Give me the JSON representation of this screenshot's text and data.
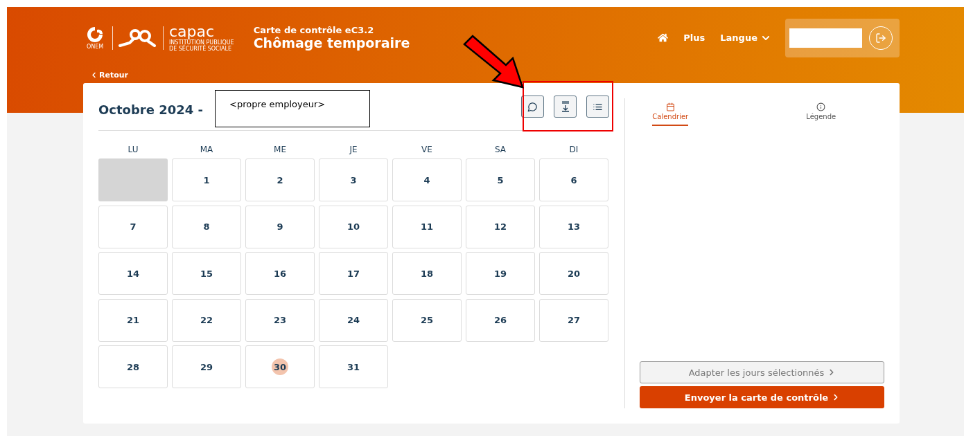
{
  "header": {
    "onem_logo": "ONEM",
    "capac_logo": "capac",
    "capac_tagline": [
      "INSTITUTION PUBLIQUE",
      "DE SÉCURITÉ SOCIALE"
    ],
    "subtitle": "Carte de contrôle eC3.2",
    "title": "Chômage temporaire",
    "back": "Retour",
    "nav": [
      "Plus",
      "Langue"
    ]
  },
  "calendar": {
    "title": "Octobre 2024 -",
    "weekdays": [
      "LU",
      "MA",
      "ME",
      "JE",
      "VE",
      "SA",
      "DI"
    ],
    "days": [
      {
        "kind": "outside"
      },
      {
        "kind": "day",
        "label": "1",
        "today": false
      },
      {
        "kind": "day",
        "label": "2",
        "today": false
      },
      {
        "kind": "day",
        "label": "3",
        "today": false
      },
      {
        "kind": "day",
        "label": "4",
        "today": false
      },
      {
        "kind": "day",
        "label": "5",
        "today": false
      },
      {
        "kind": "day",
        "label": "6",
        "today": false
      },
      {
        "kind": "day",
        "label": "7",
        "today": false
      },
      {
        "kind": "day",
        "label": "8",
        "today": false
      },
      {
        "kind": "day",
        "label": "9",
        "today": false
      },
      {
        "kind": "day",
        "label": "10",
        "today": false
      },
      {
        "kind": "day",
        "label": "11",
        "today": false
      },
      {
        "kind": "day",
        "label": "12",
        "today": false
      },
      {
        "kind": "day",
        "label": "13",
        "today": false
      },
      {
        "kind": "day",
        "label": "14",
        "today": false
      },
      {
        "kind": "day",
        "label": "15",
        "today": false
      },
      {
        "kind": "day",
        "label": "16",
        "today": false
      },
      {
        "kind": "day",
        "label": "17",
        "today": false
      },
      {
        "kind": "day",
        "label": "18",
        "today": false
      },
      {
        "kind": "day",
        "label": "19",
        "today": false
      },
      {
        "kind": "day",
        "label": "20",
        "today": false
      },
      {
        "kind": "day",
        "label": "21",
        "today": false
      },
      {
        "kind": "day",
        "label": "22",
        "today": false
      },
      {
        "kind": "day",
        "label": "23",
        "today": false
      },
      {
        "kind": "day",
        "label": "24",
        "today": false
      },
      {
        "kind": "day",
        "label": "25",
        "today": false
      },
      {
        "kind": "day",
        "label": "26",
        "today": false
      },
      {
        "kind": "day",
        "label": "27",
        "today": false
      },
      {
        "kind": "day",
        "label": "28",
        "today": false
      },
      {
        "kind": "day",
        "label": "29",
        "today": false
      },
      {
        "kind": "day",
        "label": "30",
        "today": true
      },
      {
        "kind": "day",
        "label": "31",
        "today": false
      }
    ]
  },
  "side_tabs": [
    {
      "label": "Calendrier",
      "selected": true
    },
    {
      "label": "Légende",
      "selected": false
    }
  ],
  "buttons": [
    {
      "label": "Adapter les jours sélectionnés",
      "disabled": true
    },
    {
      "label": "Envoyer la carte de contrôle",
      "disabled": false
    }
  ],
  "annotation": {
    "note": "<propre employeur>"
  }
}
